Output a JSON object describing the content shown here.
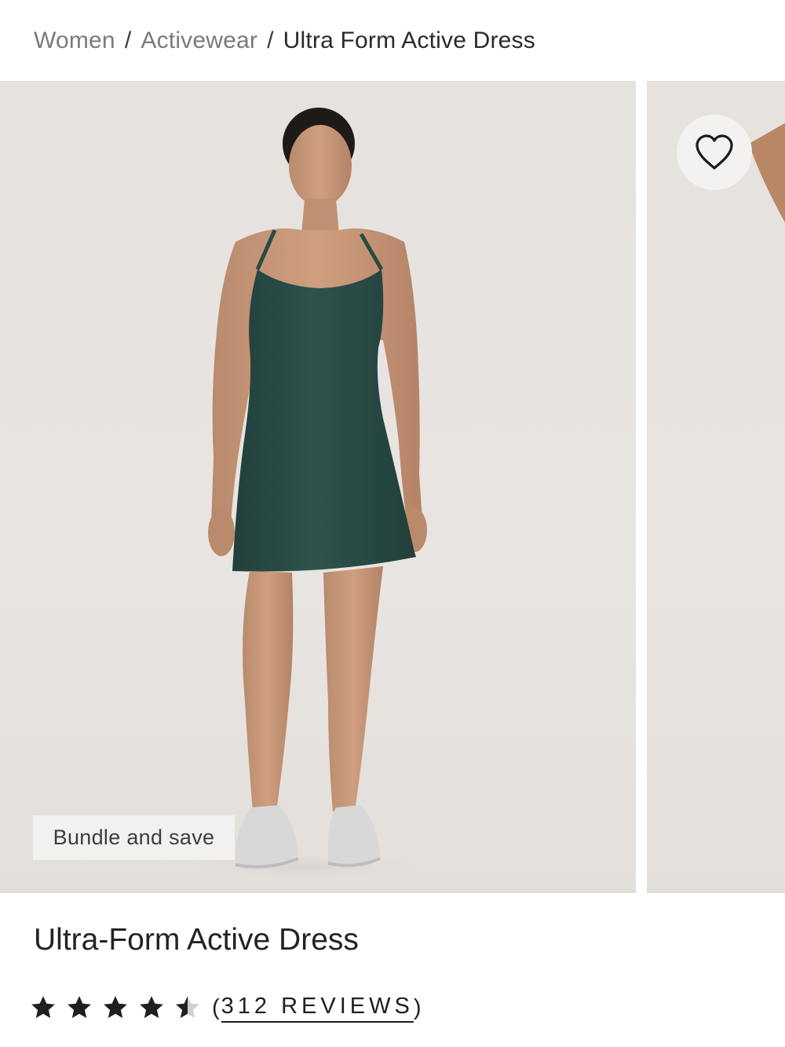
{
  "breadcrumb": {
    "items": [
      {
        "label": "Women"
      },
      {
        "label": "Activewear"
      }
    ],
    "separator": "/",
    "current": "Ultra Form Active Dress"
  },
  "gallery": {
    "badge": "Bundle and save",
    "wishlist_icon": "heart-outline-icon"
  },
  "product": {
    "title": "Ultra-Form Active Dress",
    "rating": 4.5,
    "rating_max": 5,
    "reviews_open": "(",
    "reviews_label": "312 REVIEWS",
    "reviews_close": ")"
  },
  "colors": {
    "dress": "#2c4c47",
    "background": "#e6e2de",
    "text": "#1f1f1f",
    "breadcrumb_link": "#7a7a7a"
  }
}
